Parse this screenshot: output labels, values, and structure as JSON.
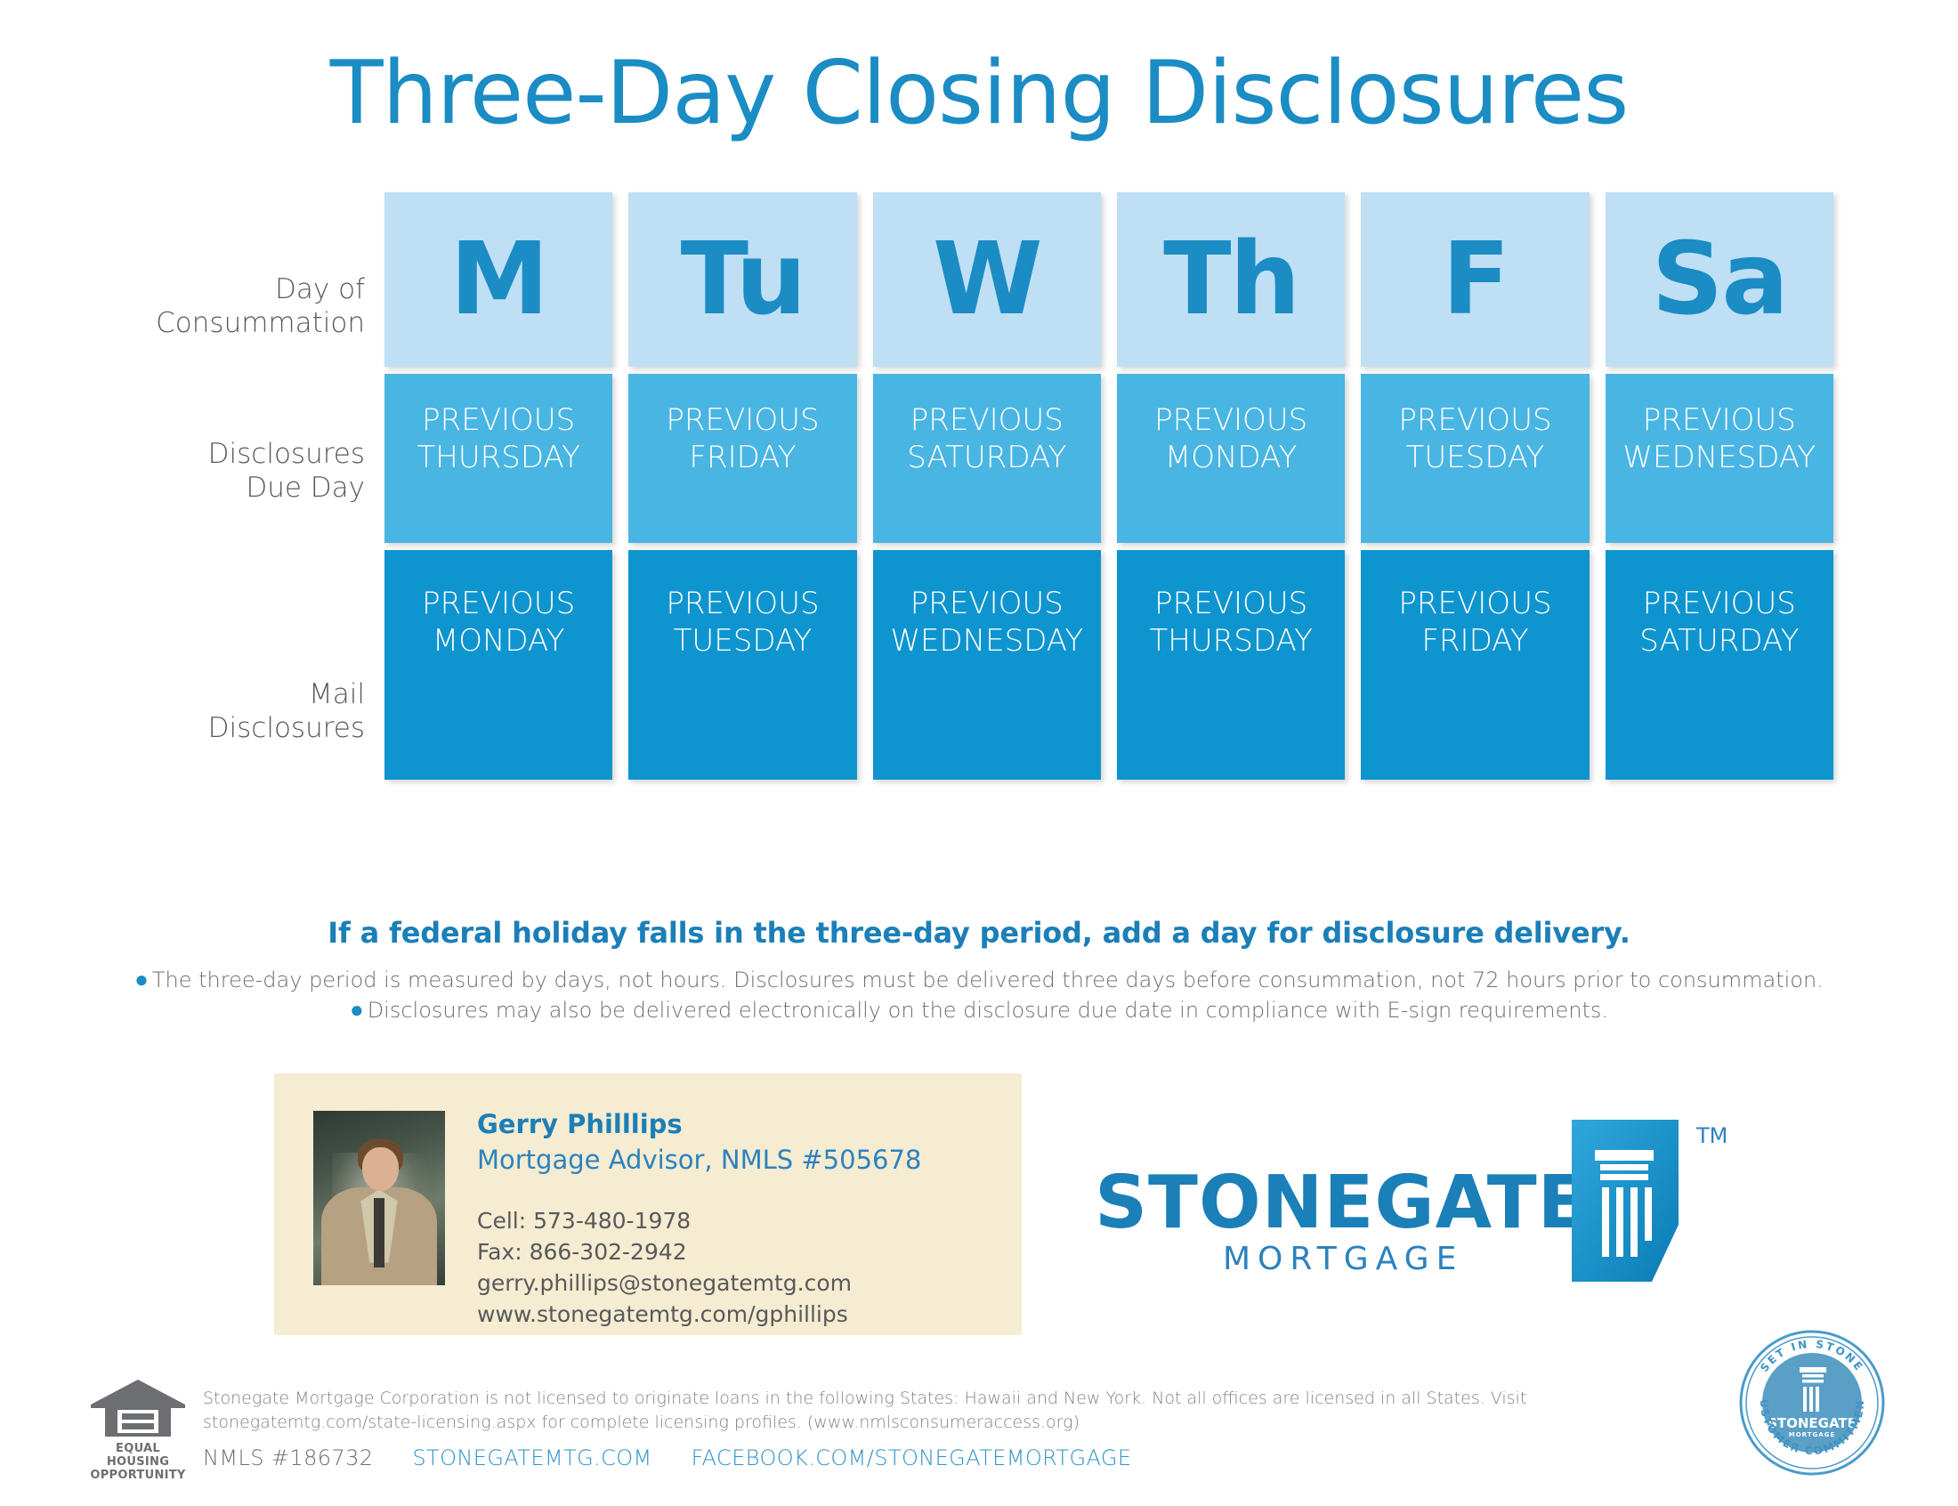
{
  "title": "Three-Day Closing Disclosures",
  "table": {
    "row_labels": {
      "consummation": "Day of\nConsummation",
      "due": "Disclosures\nDue Day",
      "mail": "Mail\nDisclosures"
    },
    "columns": [
      {
        "day": "M",
        "due": "PREVIOUS\nTHURSDAY",
        "mail": "PREVIOUS\nMONDAY"
      },
      {
        "day": "Tu",
        "due": "PREVIOUS\nFRIDAY",
        "mail": "PREVIOUS\nTUESDAY"
      },
      {
        "day": "W",
        "due": "PREVIOUS\nSATURDAY",
        "mail": "PREVIOUS\nWEDNESDAY"
      },
      {
        "day": "Th",
        "due": "PREVIOUS\nMONDAY",
        "mail": "PREVIOUS\nTHURSDAY"
      },
      {
        "day": "F",
        "due": "PREVIOUS\nTUESDAY",
        "mail": "PREVIOUS\nFRIDAY"
      },
      {
        "day": "Sa",
        "due": "PREVIOUS\nWEDNESDAY",
        "mail": "PREVIOUS\nSATURDAY"
      }
    ]
  },
  "notes": {
    "headline": "If a federal holiday falls in the three-day period, add a day for disclosure delivery.",
    "bullets": [
      "The three-day period is measured by days, not hours. Disclosures must be delivered three days before consummation, not 72 hours prior to consummation.",
      "Disclosures may also be delivered electronically on the disclosure due date in compliance with E-sign requirements."
    ]
  },
  "contact": {
    "name": "Gerry Philllips",
    "role": "Mortgage Advisor, NMLS #505678",
    "cell": "Cell: 573-480-1978",
    "fax": "Fax: 866-302-2942",
    "email": "gerry.phillips@stonegatemtg.com",
    "website": "www.stonegatemtg.com/gphillips"
  },
  "brand": {
    "name": "STONEGATE",
    "tagline": "MORTGAGE",
    "tm": "TM",
    "accent": "#1b7fb8"
  },
  "footer": {
    "equal_housing_line1": "EQUAL HOUSING",
    "equal_housing_line2": "OPPORTUNITY",
    "disclaimer": "Stonegate Mortgage Corporation is not licensed to originate loans in the following States: Hawaii and New York. Not all offices are licensed in all States. Visit stonegatemtg.com/state-licensing.aspx for complete licensing profiles. (www.nmlsconsumeraccess.org)",
    "nmls": "NMLS #186732",
    "link_site": "STONEGATEMTG.COM",
    "link_facebook": "FACEBOOK.COM/STONEGATEMORTGAGE"
  },
  "seal": {
    "top_text": "SET IN STONE",
    "bottom_text": "CUSTOMER COMMITMENT",
    "center_name": "STONEGATE",
    "center_sub": "MORTGAGE"
  },
  "colors": {
    "title_blue": "#1b8cc4",
    "head_cell": "#bfdff4",
    "due_cell": "#49b5e3",
    "mail_cell": "#0e95cf",
    "card_bg": "#f5ecd2"
  }
}
